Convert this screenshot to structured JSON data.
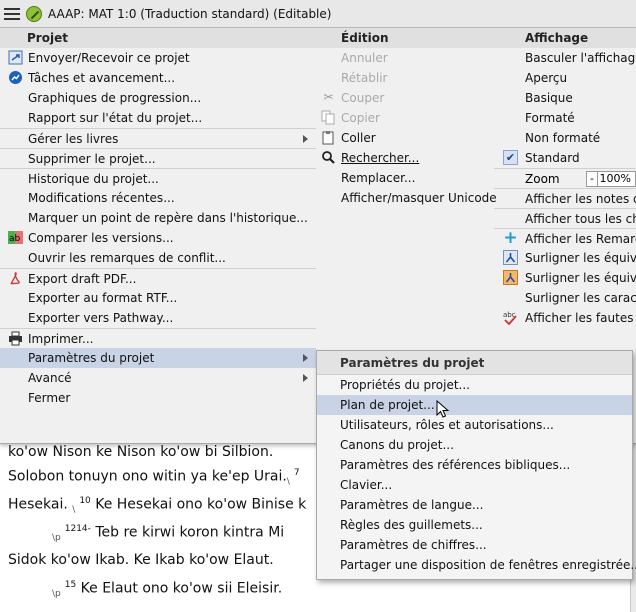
{
  "window": {
    "title": "AAAP: MAT 1:0 (Traduction standard) (Editable)"
  },
  "background": {
    "lines": [
      {
        "text": "ko'ow Nison ke Nison ko'ow bi Silbion. ",
        "marker": "",
        "verse": ""
      },
      {
        "text": "Solobon tonuyn ono witin ya ke'ep Urai.",
        "marker": "",
        "verse": "7"
      },
      {
        "text": "Hesekai.",
        "marker": "",
        "verse": "10",
        "tail": " Ke Hesekai ono ko'ow Binise k"
      },
      {
        "text": "Teb re kirwi koron kintra Mi",
        "marker": "\\p",
        "verse": "1214-"
      },
      {
        "text": "Sidok ko'ow Ikab. Ke Ikab ko'ow Elaut.",
        "marker": "",
        "verse": ""
      },
      {
        "text": "Ke Elaut ono ko'ow sii Eleisir.",
        "marker": "\\p",
        "verse": "15"
      }
    ]
  },
  "menu": {
    "projet": {
      "header": "Projet",
      "items": [
        {
          "label": "Envoyer/Recevoir ce projet",
          "icon": "send-receive-icon"
        },
        {
          "label": "Tâches et avancement...",
          "icon": "progress-icon"
        },
        {
          "label": "Graphiques de progression..."
        },
        {
          "label": "Rapport sur l'état du projet..."
        },
        {
          "label": "Gérer les livres"
        },
        {
          "label": "Supprimer le projet..."
        },
        {
          "label": "Historique du projet..."
        },
        {
          "label": "Modifications récentes..."
        },
        {
          "label": "Marquer un point de repère dans l'historique..."
        },
        {
          "label": "Comparer les versions...",
          "icon": "compare-icon"
        },
        {
          "label": "Ouvrir les remarques de conflit..."
        },
        {
          "label": "Export draft PDF...",
          "icon": "pdf-icon"
        },
        {
          "label": "Exporter au format RTF..."
        },
        {
          "label": "Exporter vers Pathway..."
        },
        {
          "label": "Imprimer...",
          "icon": "printer-icon"
        },
        {
          "label": "Paramètres du projet"
        },
        {
          "label": "Avancé"
        },
        {
          "label": "Fermer"
        }
      ]
    },
    "edition": {
      "header": "Édition",
      "items": [
        {
          "label": "Annuler"
        },
        {
          "label": "Rétablir"
        },
        {
          "label": "Couper",
          "icon": "scissors-icon"
        },
        {
          "label": "Copier",
          "icon": "copy-icon"
        },
        {
          "label": "Coller",
          "icon": "paste-icon"
        },
        {
          "label": "Rechercher...",
          "icon": "magnifier-icon"
        },
        {
          "label": "Remplacer..."
        },
        {
          "label": "Afficher/masquer Unicode"
        }
      ]
    },
    "affichage": {
      "header": "Affichage",
      "items": [
        {
          "label": "Basculer l'affichage"
        },
        {
          "label": "Aperçu"
        },
        {
          "label": "Basique"
        },
        {
          "label": "Formaté"
        },
        {
          "label": "Non formaté"
        },
        {
          "label": "Standard",
          "icon": "checkmark-icon"
        },
        {
          "label": "Zoom"
        },
        {
          "label": "Afficher les notes de"
        },
        {
          "label": "Afficher tous les cha"
        },
        {
          "label": "Afficher les Remarqu",
          "icon": "plus-icon"
        },
        {
          "label": "Surligner les équival",
          "icon": "highlight-icon"
        },
        {
          "label": "Surligner les équival",
          "icon": "highlight-icon"
        },
        {
          "label": "Surligner les caractè"
        },
        {
          "label": "Afficher les fautes d'",
          "icon": "spelling-icon"
        }
      ],
      "zoom": {
        "minus": "-",
        "value": "100%"
      }
    }
  },
  "submenu": {
    "header": "Paramètres du projet",
    "items": [
      {
        "label": "Propriétés du projet..."
      },
      {
        "label": "Plan de projet..."
      },
      {
        "label": "Utilisateurs, rôles et autorisations..."
      },
      {
        "label": "Canons du projet..."
      },
      {
        "label": "Paramètres des références bibliques..."
      },
      {
        "label": "Clavier..."
      },
      {
        "label": "Paramètres de langue..."
      },
      {
        "label": "Règles des guillemets..."
      },
      {
        "label": "Paramètres de chiffres..."
      },
      {
        "label": "Partager une disposition de fenêtres enregistrée..."
      }
    ]
  },
  "colors": {
    "selection": "#c8d3e6",
    "menu_bg": "#f0f0f0",
    "disabled": "#a9a9a9"
  }
}
